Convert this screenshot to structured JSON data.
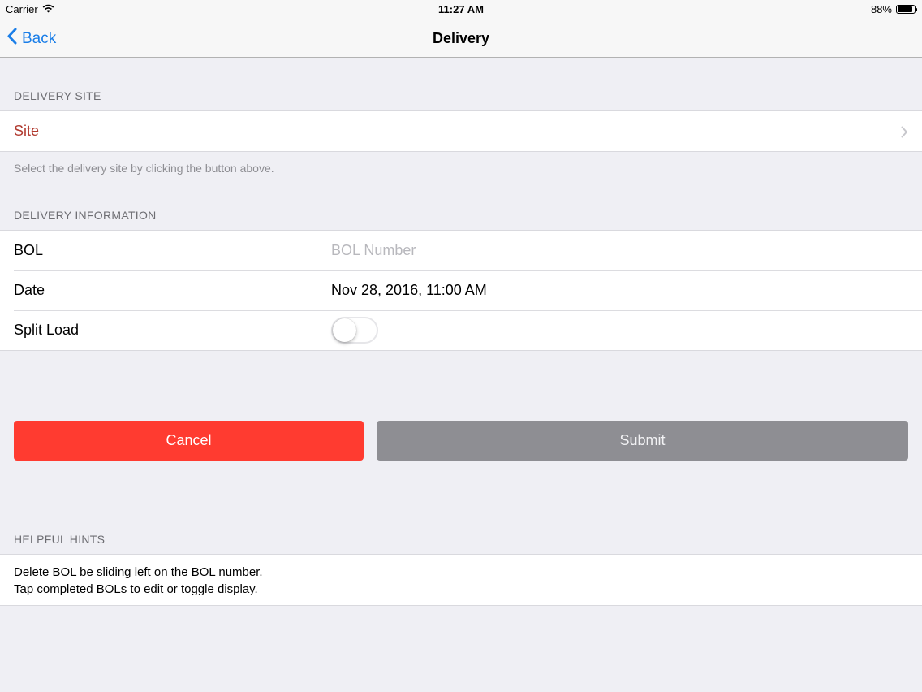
{
  "status_bar": {
    "carrier": "Carrier",
    "time": "11:27 AM",
    "battery_percent": "88%",
    "battery_level": 0.88,
    "wifi_icon": "wifi-icon",
    "battery_icon": "battery-icon"
  },
  "nav": {
    "back_label": "Back",
    "title": "Delivery",
    "back_icon": "chevron-left-icon",
    "tint_color": "#1a7ee8"
  },
  "delivery_site": {
    "header": "DELIVERY SITE",
    "site_label": "Site",
    "site_label_color": "#b13a2f",
    "chevron_icon": "chevron-right-icon",
    "footer": "Select the delivery site by clicking the button above."
  },
  "delivery_info": {
    "header": "DELIVERY INFORMATION",
    "bol_label": "BOL",
    "bol_value": "",
    "bol_placeholder": "BOL Number",
    "date_label": "Date",
    "date_value": "Nov 28, 2016, 11:00 AM",
    "split_load_label": "Split Load",
    "split_load_on": false
  },
  "actions": {
    "cancel_label": "Cancel",
    "cancel_color": "#ff3b30",
    "submit_label": "Submit",
    "submit_color": "#8e8e93"
  },
  "hints": {
    "header": "HELPFUL HINTS",
    "line1": "Delete BOL be sliding left on the BOL number.",
    "line2": "Tap completed BOLs to edit or toggle display."
  }
}
